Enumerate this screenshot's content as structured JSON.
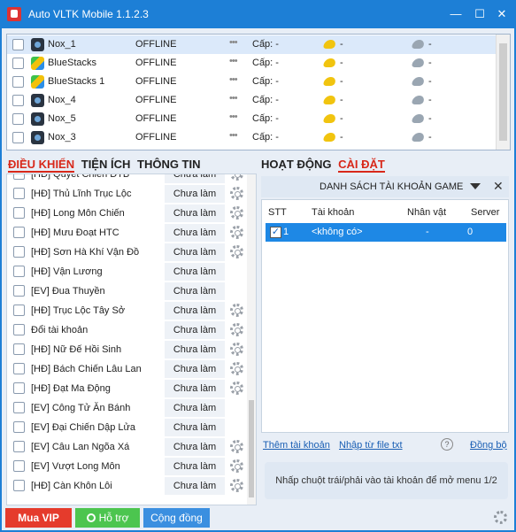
{
  "app": {
    "title": "Auto VLTK Mobile 1.1.2.3"
  },
  "window_controls": {
    "minimize": "—",
    "maximize": "☐",
    "close": "✕"
  },
  "devices": [
    {
      "name": "Nox_1",
      "status": "OFFLINE",
      "dots": "•••",
      "cap": "Cấp: -",
      "gold": "-",
      "silver": "-",
      "emulator": "nox",
      "selected": true
    },
    {
      "name": "BlueStacks",
      "status": "OFFLINE",
      "dots": "•••",
      "cap": "Cấp: -",
      "gold": "-",
      "silver": "-",
      "emulator": "bluestacks",
      "selected": false
    },
    {
      "name": "BlueStacks 1",
      "status": "OFFLINE",
      "dots": "•••",
      "cap": "Cấp: -",
      "gold": "-",
      "silver": "-",
      "emulator": "bluestacks",
      "selected": false
    },
    {
      "name": "Nox_4",
      "status": "OFFLINE",
      "dots": "•••",
      "cap": "Cấp: -",
      "gold": "-",
      "silver": "-",
      "emulator": "nox",
      "selected": false
    },
    {
      "name": "Nox_5",
      "status": "OFFLINE",
      "dots": "•••",
      "cap": "Cấp: -",
      "gold": "-",
      "silver": "-",
      "emulator": "nox",
      "selected": false
    },
    {
      "name": "Nox_3",
      "status": "OFFLINE",
      "dots": "•••",
      "cap": "Cấp: -",
      "gold": "-",
      "silver": "-",
      "emulator": "nox",
      "selected": false
    }
  ],
  "left_tabs": {
    "control": "ĐIỀU KHIỂN",
    "utility": "TIỆN ÍCH",
    "info": "THÔNG TIN",
    "active": "control"
  },
  "right_tabs": {
    "activity": "HOẠT ĐỘNG",
    "settings": "CÀI ĐẶT",
    "active": "settings"
  },
  "tasks": [
    {
      "name": "[HĐ] Quyết Chiến ĐTB",
      "status": "Chưa làm",
      "gear": true
    },
    {
      "name": "[HĐ] Thủ Lĩnh Trục Lộc",
      "status": "Chưa làm",
      "gear": true
    },
    {
      "name": "[HĐ] Long Môn Chiến",
      "status": "Chưa làm",
      "gear": true
    },
    {
      "name": "[HĐ] Mưu Đoạt HTC",
      "status": "Chưa làm",
      "gear": true
    },
    {
      "name": "[HĐ] Sơn Hà Khí Vận Đồ",
      "status": "Chưa làm",
      "gear": true
    },
    {
      "name": "[HĐ] Vận Lương",
      "status": "Chưa làm",
      "gear": false
    },
    {
      "name": "[EV] Đua Thuyền",
      "status": "Chưa làm",
      "gear": false
    },
    {
      "name": "[HĐ] Trục Lộc Tây Sở",
      "status": "Chưa làm",
      "gear": true
    },
    {
      "name": "Đổi tài khoản",
      "status": "Chưa làm",
      "gear": true
    },
    {
      "name": "[HĐ] Nữ Đế Hồi Sinh",
      "status": "Chưa làm",
      "gear": true
    },
    {
      "name": "[HĐ] Bách Chiến Lâu Lan",
      "status": "Chưa làm",
      "gear": true
    },
    {
      "name": "[HĐ] Đạt Ma Động",
      "status": "Chưa làm",
      "gear": true
    },
    {
      "name": "[EV] Công Tử Ăn Bánh",
      "status": "Chưa làm",
      "gear": false
    },
    {
      "name": "[EV] Đại Chiến Dập Lửa",
      "status": "Chưa làm",
      "gear": false
    },
    {
      "name": "[EV] Câu Lan Ngõa Xá",
      "status": "Chưa làm",
      "gear": true
    },
    {
      "name": "[EV] Vượt Long Môn",
      "status": "Chưa làm",
      "gear": true
    },
    {
      "name": "[HĐ] Càn Khôn Lôi",
      "status": "Chưa làm",
      "gear": true
    }
  ],
  "accounts": {
    "header": "DANH SÁCH TÀI KHOẢN GAME",
    "columns": {
      "stt": "STT",
      "account": "Tài khoản",
      "character": "Nhân vật",
      "server": "Server"
    },
    "rows": [
      {
        "stt": "1",
        "account": "<không có>",
        "character": "-",
        "server": "0",
        "checked": true
      }
    ],
    "check_mark": "✓"
  },
  "links": {
    "add": "Thêm tài khoản",
    "import": "Nhập từ file txt",
    "help": "?",
    "sync": "Đồng bộ"
  },
  "hint": "Nhấp chuột trái/phải vào tài khoản để mở menu 1/2",
  "footer": {
    "vip": "Mua VIP",
    "support": "Hỗ trợ",
    "community": "Cộng đồng"
  },
  "colors": {
    "titlebar": "#1d7fd6",
    "accent_red": "#d8281a",
    "selected_row": "#1e88e5",
    "vip": "#e53b2c",
    "support": "#4cc54f",
    "community": "#3b8fe0"
  }
}
